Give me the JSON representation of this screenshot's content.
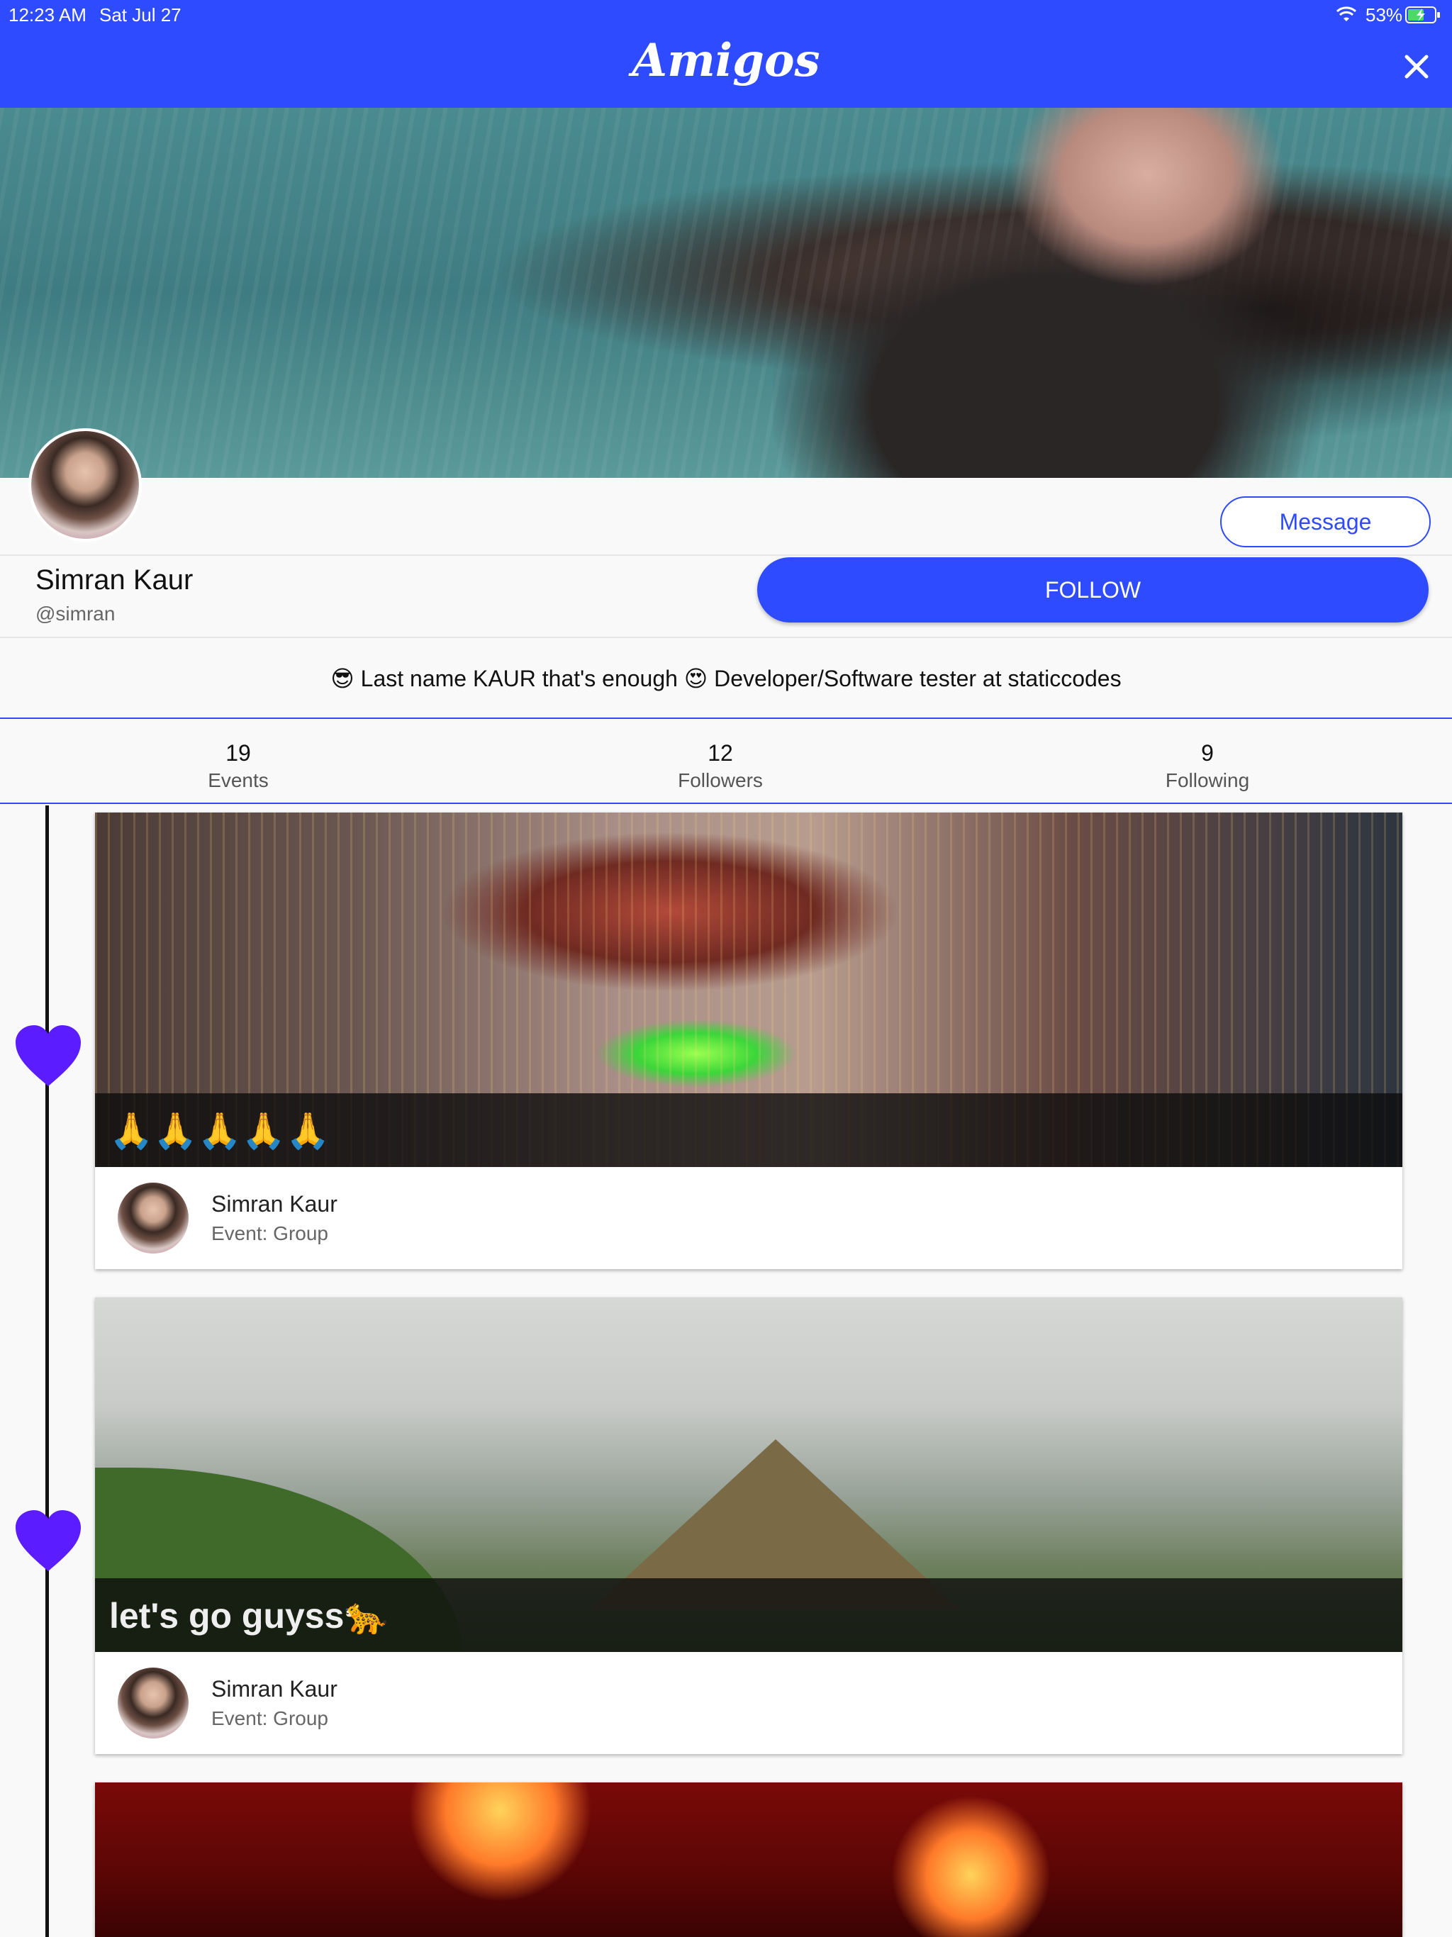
{
  "status": {
    "time": "12:23 AM",
    "date": "Sat Jul 27",
    "battery": "53%"
  },
  "header": {
    "title": "Amigos"
  },
  "profile": {
    "message_label": "Message",
    "name": "Simran Kaur",
    "handle": "@simran",
    "follow_label": "FOLLOW",
    "bio": "😎 Last name KAUR that's enough 😍 Developer/Software tester at staticcodes"
  },
  "stats": [
    {
      "value": "19",
      "label": "Events"
    },
    {
      "value": "12",
      "label": "Followers"
    },
    {
      "value": "9",
      "label": "Following"
    }
  ],
  "events": [
    {
      "caption": "🙏🙏🙏🙏🙏",
      "author": "Simran Kaur",
      "type": "Event: Group"
    },
    {
      "caption": "let's go guyss🐆",
      "author": "Simran Kaur",
      "type": "Event: Group"
    },
    {
      "caption": "",
      "author": "",
      "type": ""
    }
  ],
  "colors": {
    "accent": "#2f4bff",
    "heart": "#5b1cff"
  },
  "icons": {
    "close": "close-icon",
    "heart": "heart-icon",
    "wifi": "wifi-icon",
    "battery": "battery-icon"
  }
}
